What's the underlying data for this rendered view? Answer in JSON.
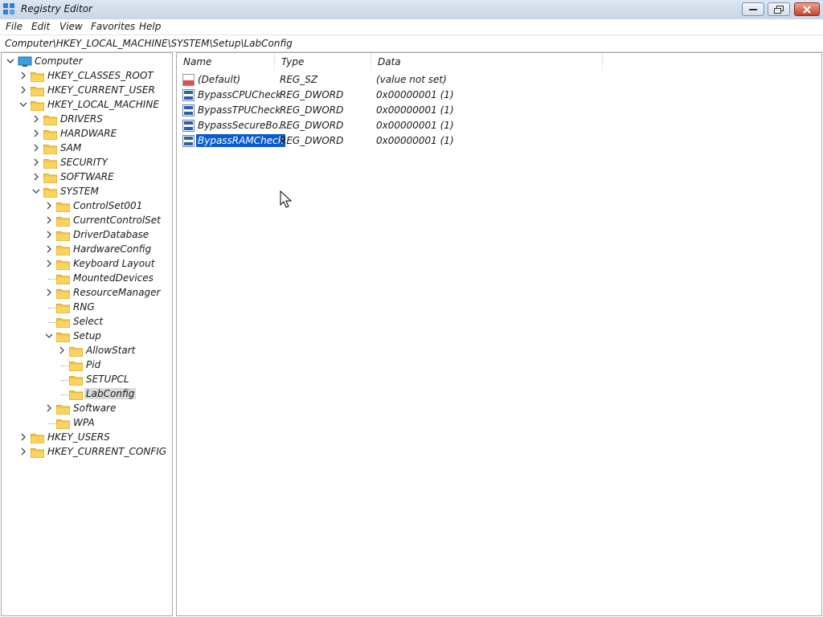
{
  "window": {
    "title": "Registry Editor",
    "icon": "registry-icon",
    "buttons": [
      "minimize",
      "maximize",
      "close"
    ]
  },
  "menu": {
    "items": [
      "File",
      "Edit",
      "View",
      "Favorites",
      "Help"
    ]
  },
  "address": {
    "path": "Computer\\HKEY_LOCAL_MACHINE\\SYSTEM\\Setup\\LabConfig"
  },
  "tree": {
    "root": "Computer",
    "items": [
      {
        "label": "HKEY_CLASSES_ROOT",
        "level": 1,
        "expanded": false,
        "has_children": true
      },
      {
        "label": "HKEY_CURRENT_USER",
        "level": 1,
        "expanded": false,
        "has_children": true
      },
      {
        "label": "HKEY_LOCAL_MACHINE",
        "level": 1,
        "expanded": true,
        "has_children": true
      },
      {
        "label": "DRIVERS",
        "level": 2,
        "expanded": false,
        "has_children": true
      },
      {
        "label": "HARDWARE",
        "level": 2,
        "expanded": false,
        "has_children": true
      },
      {
        "label": "SAM",
        "level": 2,
        "expanded": false,
        "has_children": true
      },
      {
        "label": "SECURITY",
        "level": 2,
        "expanded": false,
        "has_children": true
      },
      {
        "label": "SOFTWARE",
        "level": 2,
        "expanded": false,
        "has_children": true
      },
      {
        "label": "SYSTEM",
        "level": 2,
        "expanded": true,
        "has_children": true
      },
      {
        "label": "ControlSet001",
        "level": 3,
        "expanded": false,
        "has_children": true
      },
      {
        "label": "CurrentControlSet",
        "level": 3,
        "expanded": false,
        "has_children": true
      },
      {
        "label": "DriverDatabase",
        "level": 3,
        "expanded": false,
        "has_children": true
      },
      {
        "label": "HardwareConfig",
        "level": 3,
        "expanded": false,
        "has_children": true
      },
      {
        "label": "Keyboard Layout",
        "level": 3,
        "expanded": false,
        "has_children": true
      },
      {
        "label": "MountedDevices",
        "level": 3,
        "expanded": false,
        "has_children": false
      },
      {
        "label": "ResourceManager",
        "level": 3,
        "expanded": false,
        "has_children": true
      },
      {
        "label": "RNG",
        "level": 3,
        "expanded": false,
        "has_children": false
      },
      {
        "label": "Select",
        "level": 3,
        "expanded": false,
        "has_children": false
      },
      {
        "label": "Setup",
        "level": 3,
        "expanded": true,
        "has_children": true
      },
      {
        "label": "AllowStart",
        "level": 4,
        "expanded": false,
        "has_children": true
      },
      {
        "label": "Pid",
        "level": 4,
        "expanded": false,
        "has_children": false
      },
      {
        "label": "SETUPCL",
        "level": 4,
        "expanded": false,
        "has_children": false
      },
      {
        "label": "LabConfig",
        "level": 4,
        "expanded": false,
        "has_children": false,
        "selected": true
      },
      {
        "label": "Software",
        "level": 3,
        "expanded": false,
        "has_children": true
      },
      {
        "label": "WPA",
        "level": 3,
        "expanded": false,
        "has_children": false
      },
      {
        "label": "HKEY_USERS",
        "level": 1,
        "expanded": false,
        "has_children": true
      },
      {
        "label": "HKEY_CURRENT_CONFIG",
        "level": 1,
        "expanded": false,
        "has_children": true
      }
    ]
  },
  "values": {
    "columns": [
      "Name",
      "Type",
      "Data"
    ],
    "rows": [
      {
        "name": "(Default)",
        "type": "REG_SZ",
        "data": "(value not set)",
        "icon": "string-value-icon"
      },
      {
        "name": "BypassCPUCheck",
        "type": "REG_DWORD",
        "data": "0x00000001 (1)",
        "icon": "binary-value-icon"
      },
      {
        "name": "BypassTPUCheck",
        "type": "REG_DWORD",
        "data": "0x00000001 (1)",
        "icon": "binary-value-icon"
      },
      {
        "name": "BypassSecureBo...",
        "type": "REG_DWORD",
        "data": "0x00000001 (1)",
        "icon": "binary-value-icon"
      },
      {
        "name": "BypassRAMCheck",
        "type": "REG_DWORD",
        "data": "0x00000001 (1)",
        "icon": "binary-value-icon",
        "selected": true
      }
    ]
  },
  "colors": {
    "selection": "#0a5bd0",
    "folder": "#f5c542",
    "tree_selection": "#d9d9d9"
  }
}
